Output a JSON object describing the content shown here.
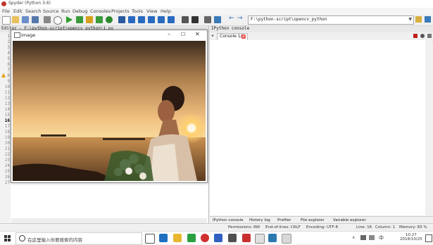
{
  "window": {
    "title": "Spyder (Python 3.6)"
  },
  "menu": [
    "File",
    "Edit",
    "Search",
    "Source",
    "Run",
    "Debug",
    "Consoles",
    "Projects",
    "Tools",
    "View",
    "Help"
  ],
  "toolbar": {
    "path": "F:\\python-script\\opencv_python"
  },
  "editor": {
    "header": "Editor - F:\\python-script\\opencv_python\\1.py",
    "line_numbers": [
      "1",
      "2",
      "3",
      "4",
      "5",
      "6",
      "7",
      "8",
      "9",
      "10",
      "11",
      "12",
      "13",
      "14",
      "15",
      "16",
      "17",
      "18",
      "19",
      "20",
      "21",
      "22",
      "23",
      "24",
      "25",
      "26",
      "27"
    ]
  },
  "image_window": {
    "title": "image"
  },
  "console": {
    "header": "IPython console",
    "tab_label": "Console 1/A",
    "bottom_tabs": [
      "IPython console",
      "History log",
      "Profiler",
      "File explorer",
      "Variable explorer"
    ]
  },
  "status": {
    "permissions": "Permissions: RW",
    "eol": "End-of-lines: CRLF",
    "encoding": "Encoding: UTF-8",
    "line": "Line: 16",
    "column": "Column: 1",
    "memory": "Memory: 83 %"
  },
  "taskbar": {
    "search_placeholder": "在这里输入你要搜索的内容",
    "time": "10:27",
    "date": "2018/10/25"
  }
}
